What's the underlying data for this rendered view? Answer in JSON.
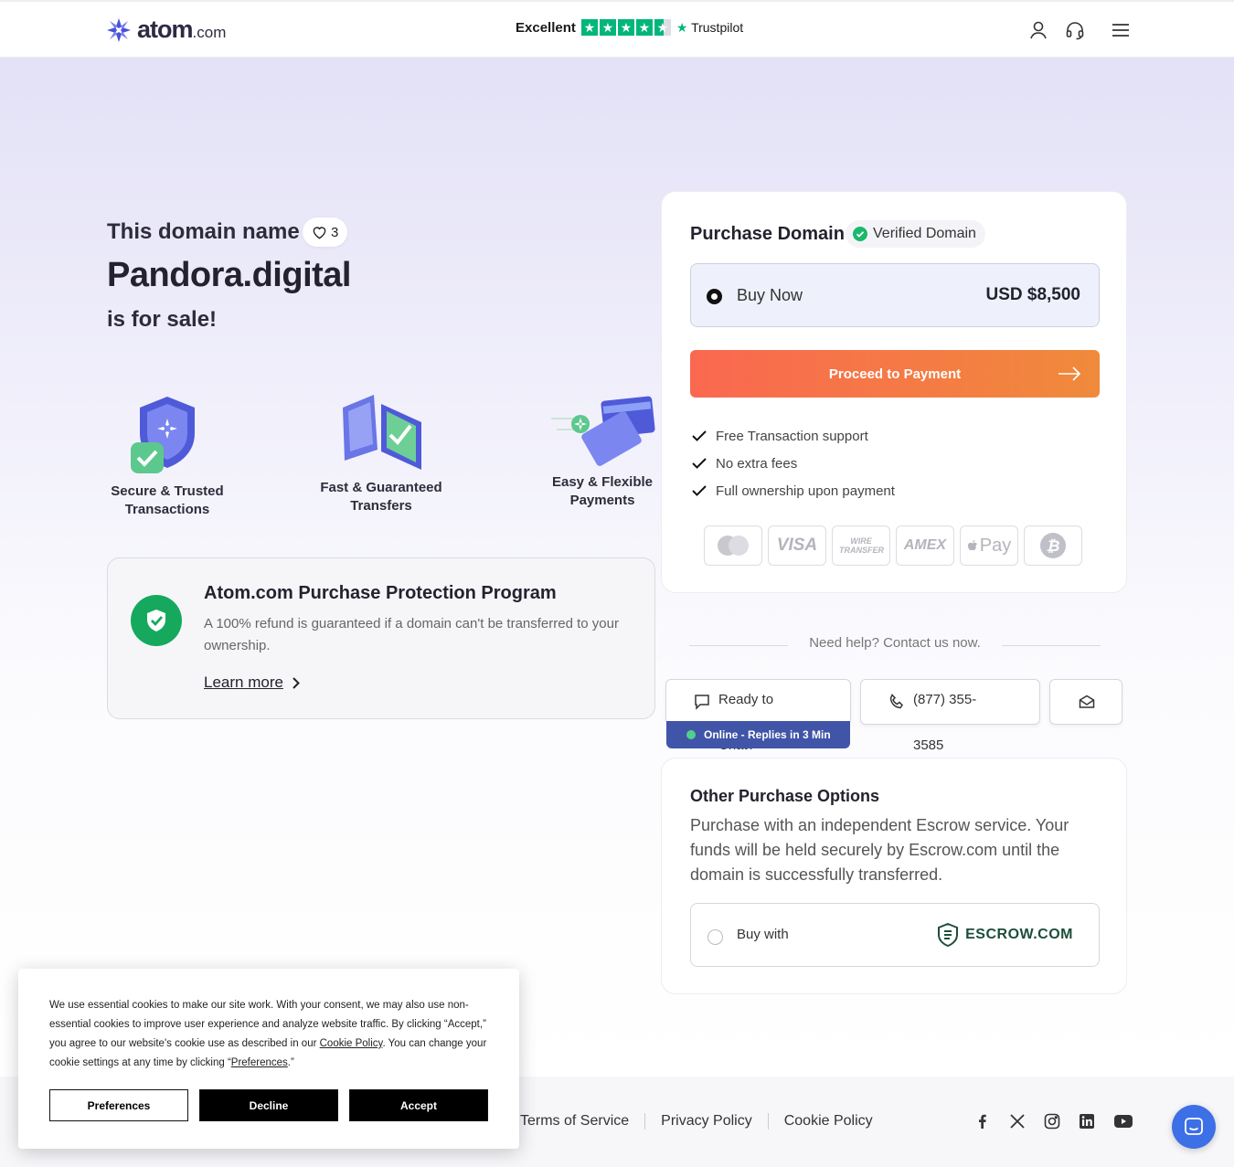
{
  "header": {
    "logo_text": "atom",
    "logo_suffix": ".com",
    "trust_label": "Excellent",
    "trust_brand": "Trustpilot",
    "trust_rating": 4.5
  },
  "hero": {
    "title": "This domain name",
    "favorite_count": "3",
    "domain": "Pandora.digital",
    "for_sale": "is for sale!"
  },
  "features": [
    {
      "line1": "Secure & Trusted",
      "line2": "Transactions"
    },
    {
      "line1": "Fast & Guaranteed",
      "line2": "Transfers"
    },
    {
      "line1": "Easy & Flexible",
      "line2": "Payments"
    }
  ],
  "protection": {
    "title": "Atom.com Purchase Protection Program",
    "text": "A 100% refund is guaranteed if a domain can't be transferred to your ownership.",
    "link": "Learn more"
  },
  "purchase": {
    "title": "Purchase Domain",
    "verified": "Verified Domain",
    "option_label": "Buy Now",
    "price": "USD $8,500",
    "cta": "Proceed to Payment",
    "benefits": [
      "Free Transaction support",
      "No extra fees",
      "Full ownership upon payment"
    ],
    "payments": [
      "mastercard",
      "VISA",
      "WIRE TRANSFER",
      "AMEX",
      "Pay",
      "bitcoin"
    ]
  },
  "help": {
    "text": "Need help? Contact us now.",
    "chat": "Ready to Chat?",
    "phone": "(877) 355-3585",
    "online": "Online - Replies in 3 Min"
  },
  "other": {
    "title": "Other Purchase Options",
    "text": "Purchase with an independent Escrow service. Your funds will be held securely by Escrow.com until the domain is successfully transferred.",
    "option_label": "Buy with",
    "escrow_logo": "ESCROW.COM"
  },
  "footer": {
    "links": [
      "Terms of Service",
      "Privacy Policy",
      "Cookie Policy"
    ]
  },
  "cookie": {
    "text_a": "We use essential cookies to make our site work. With your consent, we may also use non-essential cookies to improve user experience and analyze website traffic. By clicking “Accept,” you agree to our website's cookie use as described in our ",
    "link_a": "Cookie Policy",
    "text_b": ". You can change your cookie settings at any time by clicking “",
    "link_b": "Preferences",
    "text_c": ".”",
    "btn_prefs": "Preferences",
    "btn_decline": "Decline",
    "btn_accept": "Accept"
  },
  "colors": {
    "accent_orange": "#fa6850",
    "trust_green": "#00b67a",
    "protect_green": "#16a95e",
    "online_blue": "#4155a8"
  }
}
